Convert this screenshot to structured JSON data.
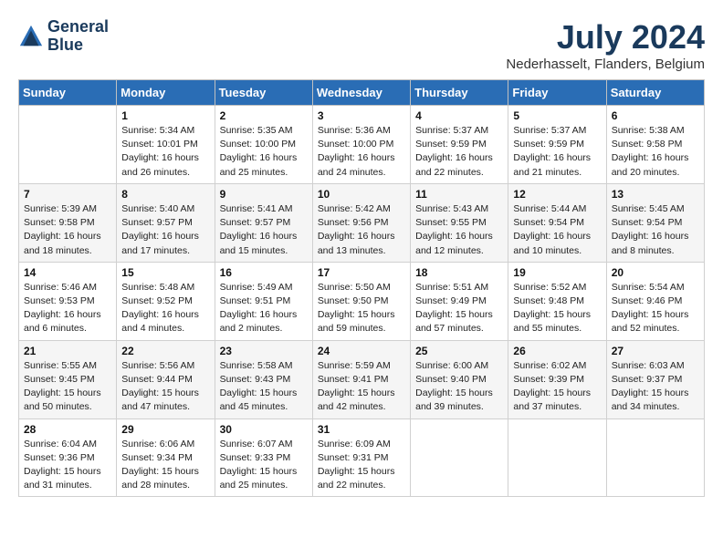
{
  "header": {
    "logo_line1": "General",
    "logo_line2": "Blue",
    "month_year": "July 2024",
    "location": "Nederhasselt, Flanders, Belgium"
  },
  "weekdays": [
    "Sunday",
    "Monday",
    "Tuesday",
    "Wednesday",
    "Thursday",
    "Friday",
    "Saturday"
  ],
  "weeks": [
    [
      {
        "day": "",
        "info": ""
      },
      {
        "day": "1",
        "info": "Sunrise: 5:34 AM\nSunset: 10:01 PM\nDaylight: 16 hours\nand 26 minutes."
      },
      {
        "day": "2",
        "info": "Sunrise: 5:35 AM\nSunset: 10:00 PM\nDaylight: 16 hours\nand 25 minutes."
      },
      {
        "day": "3",
        "info": "Sunrise: 5:36 AM\nSunset: 10:00 PM\nDaylight: 16 hours\nand 24 minutes."
      },
      {
        "day": "4",
        "info": "Sunrise: 5:37 AM\nSunset: 9:59 PM\nDaylight: 16 hours\nand 22 minutes."
      },
      {
        "day": "5",
        "info": "Sunrise: 5:37 AM\nSunset: 9:59 PM\nDaylight: 16 hours\nand 21 minutes."
      },
      {
        "day": "6",
        "info": "Sunrise: 5:38 AM\nSunset: 9:58 PM\nDaylight: 16 hours\nand 20 minutes."
      }
    ],
    [
      {
        "day": "7",
        "info": "Sunrise: 5:39 AM\nSunset: 9:58 PM\nDaylight: 16 hours\nand 18 minutes."
      },
      {
        "day": "8",
        "info": "Sunrise: 5:40 AM\nSunset: 9:57 PM\nDaylight: 16 hours\nand 17 minutes."
      },
      {
        "day": "9",
        "info": "Sunrise: 5:41 AM\nSunset: 9:57 PM\nDaylight: 16 hours\nand 15 minutes."
      },
      {
        "day": "10",
        "info": "Sunrise: 5:42 AM\nSunset: 9:56 PM\nDaylight: 16 hours\nand 13 minutes."
      },
      {
        "day": "11",
        "info": "Sunrise: 5:43 AM\nSunset: 9:55 PM\nDaylight: 16 hours\nand 12 minutes."
      },
      {
        "day": "12",
        "info": "Sunrise: 5:44 AM\nSunset: 9:54 PM\nDaylight: 16 hours\nand 10 minutes."
      },
      {
        "day": "13",
        "info": "Sunrise: 5:45 AM\nSunset: 9:54 PM\nDaylight: 16 hours\nand 8 minutes."
      }
    ],
    [
      {
        "day": "14",
        "info": "Sunrise: 5:46 AM\nSunset: 9:53 PM\nDaylight: 16 hours\nand 6 minutes."
      },
      {
        "day": "15",
        "info": "Sunrise: 5:48 AM\nSunset: 9:52 PM\nDaylight: 16 hours\nand 4 minutes."
      },
      {
        "day": "16",
        "info": "Sunrise: 5:49 AM\nSunset: 9:51 PM\nDaylight: 16 hours\nand 2 minutes."
      },
      {
        "day": "17",
        "info": "Sunrise: 5:50 AM\nSunset: 9:50 PM\nDaylight: 15 hours\nand 59 minutes."
      },
      {
        "day": "18",
        "info": "Sunrise: 5:51 AM\nSunset: 9:49 PM\nDaylight: 15 hours\nand 57 minutes."
      },
      {
        "day": "19",
        "info": "Sunrise: 5:52 AM\nSunset: 9:48 PM\nDaylight: 15 hours\nand 55 minutes."
      },
      {
        "day": "20",
        "info": "Sunrise: 5:54 AM\nSunset: 9:46 PM\nDaylight: 15 hours\nand 52 minutes."
      }
    ],
    [
      {
        "day": "21",
        "info": "Sunrise: 5:55 AM\nSunset: 9:45 PM\nDaylight: 15 hours\nand 50 minutes."
      },
      {
        "day": "22",
        "info": "Sunrise: 5:56 AM\nSunset: 9:44 PM\nDaylight: 15 hours\nand 47 minutes."
      },
      {
        "day": "23",
        "info": "Sunrise: 5:58 AM\nSunset: 9:43 PM\nDaylight: 15 hours\nand 45 minutes."
      },
      {
        "day": "24",
        "info": "Sunrise: 5:59 AM\nSunset: 9:41 PM\nDaylight: 15 hours\nand 42 minutes."
      },
      {
        "day": "25",
        "info": "Sunrise: 6:00 AM\nSunset: 9:40 PM\nDaylight: 15 hours\nand 39 minutes."
      },
      {
        "day": "26",
        "info": "Sunrise: 6:02 AM\nSunset: 9:39 PM\nDaylight: 15 hours\nand 37 minutes."
      },
      {
        "day": "27",
        "info": "Sunrise: 6:03 AM\nSunset: 9:37 PM\nDaylight: 15 hours\nand 34 minutes."
      }
    ],
    [
      {
        "day": "28",
        "info": "Sunrise: 6:04 AM\nSunset: 9:36 PM\nDaylight: 15 hours\nand 31 minutes."
      },
      {
        "day": "29",
        "info": "Sunrise: 6:06 AM\nSunset: 9:34 PM\nDaylight: 15 hours\nand 28 minutes."
      },
      {
        "day": "30",
        "info": "Sunrise: 6:07 AM\nSunset: 9:33 PM\nDaylight: 15 hours\nand 25 minutes."
      },
      {
        "day": "31",
        "info": "Sunrise: 6:09 AM\nSunset: 9:31 PM\nDaylight: 15 hours\nand 22 minutes."
      },
      {
        "day": "",
        "info": ""
      },
      {
        "day": "",
        "info": ""
      },
      {
        "day": "",
        "info": ""
      }
    ]
  ]
}
